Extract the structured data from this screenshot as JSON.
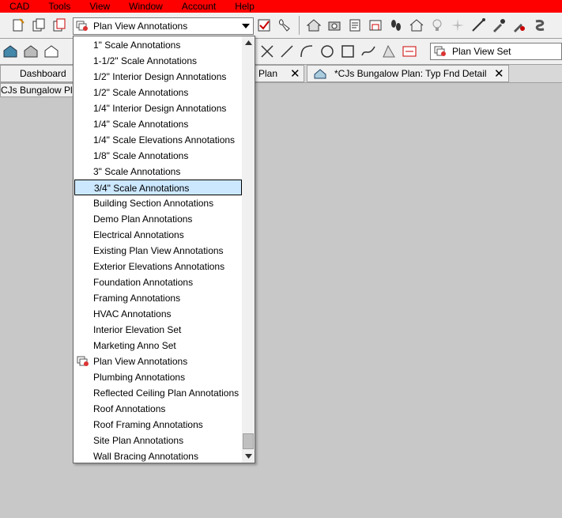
{
  "menubar": {
    "items": [
      "CAD",
      "Tools",
      "View",
      "Window",
      "Account",
      "Help"
    ],
    "bg_color": "#ff0000"
  },
  "layer_combo": {
    "selected": "Plan View Annotations"
  },
  "layer_set_combo": {
    "selected": "Plan View Set"
  },
  "tabs": {
    "dashboard": "Dashboard",
    "plan": "Plan",
    "fnd_detail": "*CJs Bungalow Plan: Typ Fnd Detail",
    "close": "✕"
  },
  "subtab": {
    "label": "CJs Bungalow Pla"
  },
  "dropdown": {
    "items": [
      "1\" Scale Annotations",
      "1-1/2\" Scale Annotations",
      "1/2\" Interior Design Annotations",
      "1/2\" Scale Annotations",
      "1/4\" Interior Design Annotations",
      "1/4\" Scale Annotations",
      "1/4\" Scale Elevations Annotations",
      "1/8\" Scale Annotations",
      "3\" Scale Annotations",
      "3/4\" Scale Annotations",
      "Building Section Annotations",
      "Demo Plan Annotations",
      "Electrical Annotations",
      "Existing Plan View Annotations",
      "Exterior Elevations Annotations",
      "Foundation Annotations",
      "Framing Annotations",
      "HVAC Annotations",
      "Interior Elevation Set",
      "Marketing Anno Set",
      "Plan View Annotations",
      "Plumbing Annotations",
      "Reflected Ceiling Plan Annotations",
      "Roof Annotations",
      "Roof Framing Annotations",
      "Site Plan Annotations",
      "Wall Bracing Annotations"
    ],
    "highlighted_index": 9,
    "active_index": 20,
    "highlight_color": "#cce8ff"
  }
}
